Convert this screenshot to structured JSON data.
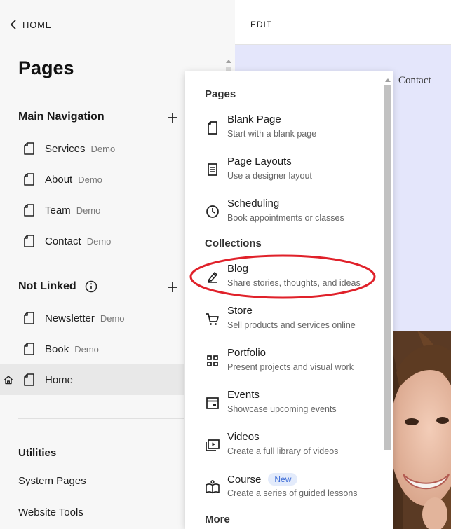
{
  "left_panel": {
    "home_link": "HOME",
    "title": "Pages",
    "main_navigation": {
      "label": "Main Navigation",
      "items": [
        {
          "label": "Services",
          "tag": "Demo"
        },
        {
          "label": "About",
          "tag": "Demo"
        },
        {
          "label": "Team",
          "tag": "Demo"
        },
        {
          "label": "Contact",
          "tag": "Demo"
        }
      ]
    },
    "not_linked": {
      "label": "Not Linked",
      "items": [
        {
          "label": "Newsletter",
          "tag": "Demo"
        },
        {
          "label": "Book",
          "tag": "Demo"
        },
        {
          "label": "Home",
          "tag": ""
        }
      ]
    },
    "utilities": {
      "label": "Utilities",
      "items": [
        "System Pages",
        "Website Tools"
      ]
    }
  },
  "preview": {
    "edit_label": "EDIT",
    "nav_link": "Contact"
  },
  "menu": {
    "pages_section": "Pages",
    "pages_items": [
      {
        "title": "Blank Page",
        "subtitle": "Start with a blank page",
        "icon": "blank-page-icon"
      },
      {
        "title": "Page Layouts",
        "subtitle": "Use a designer layout",
        "icon": "layout-icon"
      },
      {
        "title": "Scheduling",
        "subtitle": "Book appointments or classes",
        "icon": "clock-icon"
      }
    ],
    "collections_section": "Collections",
    "collection_items": [
      {
        "title": "Blog",
        "subtitle": "Share stories, thoughts, and ideas",
        "icon": "pen-icon"
      },
      {
        "title": "Store",
        "subtitle": "Sell products and services online",
        "icon": "cart-icon"
      },
      {
        "title": "Portfolio",
        "subtitle": "Present projects and visual work",
        "icon": "grid-icon"
      },
      {
        "title": "Events",
        "subtitle": "Showcase upcoming events",
        "icon": "calendar-icon"
      },
      {
        "title": "Videos",
        "subtitle": "Create a full library of videos",
        "icon": "video-icon"
      },
      {
        "title": "Course",
        "subtitle": "Create a series of guided lessons",
        "icon": "book-icon",
        "badge": "New"
      }
    ],
    "more_section": "More"
  },
  "colors": {
    "annotation": "#e0212a",
    "badge_text": "#3c6bd6",
    "badge_bg": "#e3ebfb",
    "preview_bg": "#e4e6fb"
  }
}
